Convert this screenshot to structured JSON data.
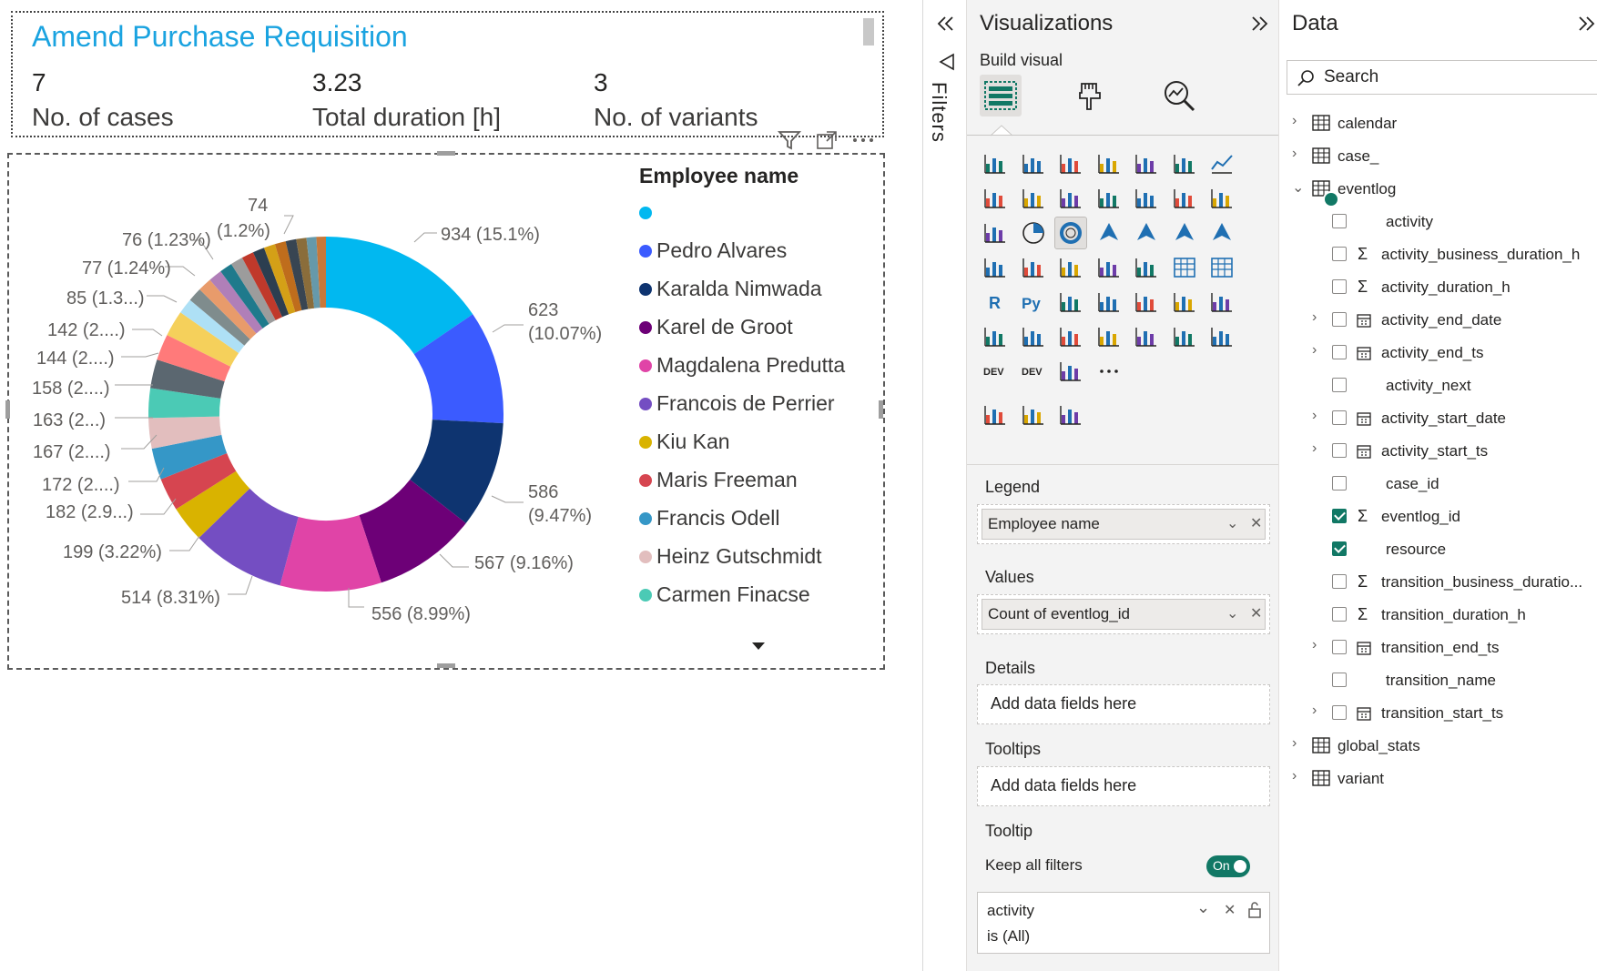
{
  "report": {
    "title": "Amend Purchase Requisition",
    "kpis": [
      {
        "value": "7",
        "label": "No. of cases"
      },
      {
        "value": "3.23",
        "label": "Total duration [h]"
      },
      {
        "value": "3",
        "label": "No. of variants"
      }
    ],
    "legend": {
      "title": "Employee name",
      "items": [
        {
          "name": "",
          "color": "#01b8f0"
        },
        {
          "name": "Pedro Alvares",
          "color": "#3b5bff"
        },
        {
          "name": "Karalda Nimwada",
          "color": "#0e3470"
        },
        {
          "name": "Karel de Groot",
          "color": "#6d0077"
        },
        {
          "name": "Magdalena Predutta",
          "color": "#e044a7"
        },
        {
          "name": "Francois de Perrier",
          "color": "#744ec2"
        },
        {
          "name": "Kiu Kan",
          "color": "#d9b300"
        },
        {
          "name": "Maris Freeman",
          "color": "#d64550"
        },
        {
          "name": "Francis Odell",
          "color": "#3597c7"
        },
        {
          "name": "Heinz Gutschmidt",
          "color": "#e2bebe"
        },
        {
          "name": "Carmen Finacse",
          "color": "#4bcab5"
        }
      ]
    }
  },
  "chart_data": {
    "type": "pie",
    "donut": true,
    "legend_title": "Employee name",
    "values": [
      934,
      623,
      586,
      567,
      556,
      514,
      199,
      182,
      172,
      167,
      163,
      158,
      144,
      142,
      85,
      77,
      76,
      74,
      70,
      68,
      66,
      64,
      62,
      60,
      58,
      56,
      54,
      52
    ],
    "colors": [
      "#01b8f0",
      "#3b5bff",
      "#0e3470",
      "#6d0077",
      "#e044a7",
      "#744ec2",
      "#d9b300",
      "#d64550",
      "#3597c7",
      "#e2bebe",
      "#4bcab5",
      "#5b6770",
      "#ff7a7a",
      "#f5d05b",
      "#aee0f5",
      "#7f8c8d",
      "#e89b6b",
      "#b07fb8",
      "#1f7a8c",
      "#9c9c9c",
      "#c0392b",
      "#2c3e50",
      "#d4a017",
      "#bf6d1c",
      "#384552",
      "#8a6d3b",
      "#6699aa",
      "#c7783a"
    ],
    "data_labels": [
      {
        "text": "934 (15.1%)"
      },
      {
        "text": "623"
      },
      {
        "text": "(10.07%)"
      },
      {
        "text": "586"
      },
      {
        "text": "(9.47%)"
      },
      {
        "text": "567 (9.16%)"
      },
      {
        "text": "556 (8.99%)"
      },
      {
        "text": "514 (8.31%)"
      },
      {
        "text": "199 (3.22%)"
      },
      {
        "text": "182 (2.9...)"
      },
      {
        "text": "172 (2....)"
      },
      {
        "text": "167 (2....)"
      },
      {
        "text": "163 (2...)"
      },
      {
        "text": "158 (2....)"
      },
      {
        "text": "144 (2....)"
      },
      {
        "text": "142 (2....)"
      },
      {
        "text": "85 (1.3...)"
      },
      {
        "text": "77 (1.24%)"
      },
      {
        "text": "76 (1.23%)"
      },
      {
        "text": "74"
      },
      {
        "text": "(1.2%)"
      }
    ]
  },
  "filters_pane": {
    "label": "Filters"
  },
  "visualizations": {
    "title": "Visualizations",
    "build_visual": "Build visual",
    "wells": {
      "legend_label": "Legend",
      "legend_field": "Employee name",
      "values_label": "Values",
      "values_field": "Count of eventlog_id",
      "details_label": "Details",
      "details_placeholder": "Add data fields here",
      "tooltips_label": "Tooltips",
      "tooltips_placeholder": "Add data fields here"
    },
    "tooltip": {
      "label": "Tooltip",
      "keep_all_filters": "Keep all filters",
      "toggle": "On",
      "filter_field": "activity",
      "filter_value": "is (All)"
    }
  },
  "data_pane": {
    "title": "Data",
    "search_placeholder": "Search",
    "tables": [
      {
        "name": "calendar"
      },
      {
        "name": "case_"
      },
      {
        "name": "eventlog"
      },
      {
        "name": "global_stats"
      },
      {
        "name": "variant"
      }
    ],
    "eventlog_fields": [
      {
        "name": "activity",
        "checked": false
      },
      {
        "name": "activity_business_duration_h",
        "checked": false
      },
      {
        "name": "activity_duration_h",
        "checked": false
      },
      {
        "name": "activity_end_date",
        "checked": false
      },
      {
        "name": "activity_end_ts",
        "checked": false
      },
      {
        "name": "activity_next",
        "checked": false
      },
      {
        "name": "activity_start_date",
        "checked": false
      },
      {
        "name": "activity_start_ts",
        "checked": false
      },
      {
        "name": "case_id",
        "checked": false
      },
      {
        "name": "eventlog_id",
        "checked": true
      },
      {
        "name": "resource",
        "checked": true
      },
      {
        "name": "transition_business_duratio...",
        "checked": false
      },
      {
        "name": "transition_duration_h",
        "checked": false
      },
      {
        "name": "transition_end_ts",
        "checked": false
      },
      {
        "name": "transition_name",
        "checked": false
      },
      {
        "name": "transition_start_ts",
        "checked": false
      }
    ]
  }
}
